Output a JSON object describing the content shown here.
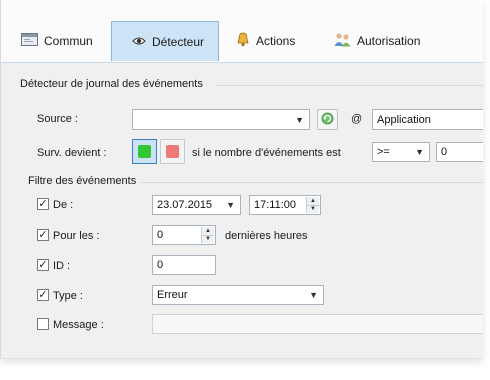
{
  "tabs": [
    {
      "label": "Commun",
      "icon": "window-icon"
    },
    {
      "label": "Détecteur",
      "icon": "eye-icon"
    },
    {
      "label": "Actions",
      "icon": "bell-icon"
    },
    {
      "label": "Autorisation",
      "icon": "users-icon"
    }
  ],
  "detector": {
    "section_title": "Détecteur de journal des événements",
    "source_label": "Source :",
    "source_value": "",
    "at_symbol": "@",
    "computer_value": "Application",
    "surv_label": "Surv. devient :",
    "condition_text": "si le nombre d'événements est",
    "operator_value": ">=",
    "count_value": "0",
    "green_color": "#33c733",
    "red_color": "#f07878"
  },
  "filter": {
    "section_title": "Filtre des événements",
    "date": {
      "label": "De :",
      "checked": true,
      "date_value": "23.07.2015",
      "time_value": "17:11:00"
    },
    "hours": {
      "label": "Pour les :",
      "checked": true,
      "value": "0",
      "suffix": "dernières heures"
    },
    "id": {
      "label": "ID :",
      "checked": true,
      "value": "0"
    },
    "type": {
      "label": "Type :",
      "checked": true,
      "value": "Erreur"
    },
    "message": {
      "label": "Message :",
      "checked": false,
      "value": ""
    }
  },
  "colors": {
    "accent_tab": "#cde4f7",
    "accent_border": "#8fb6da"
  }
}
